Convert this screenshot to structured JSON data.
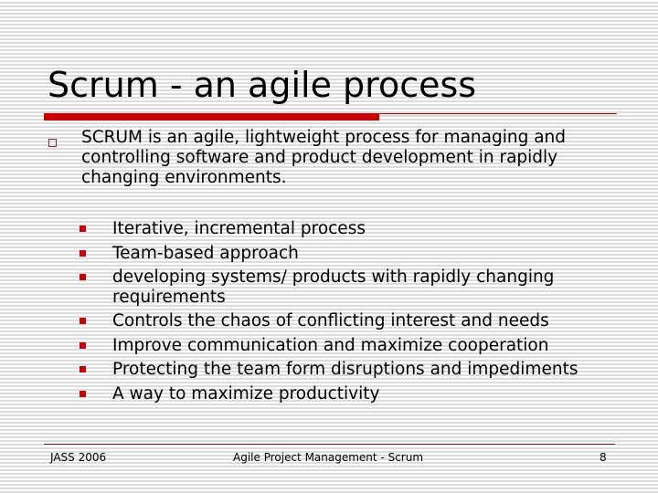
{
  "slide": {
    "title": "Scrum - an agile process",
    "main_bullet": "SCRUM is an agile, lightweight process for managing and controlling software and product development in rapidly changing environments.",
    "sub_bullets": [
      "Iterative, incremental process",
      "Team-based approach",
      "developing systems/ products with rapidly changing requirements",
      "Controls the chaos of conflicting interest and needs",
      "Improve communication and maximize cooperation",
      "Protecting the team form disruptions and impediments",
      "A way to maximize productivity"
    ]
  },
  "footer": {
    "left": "JASS 2006",
    "center": "Agile Project Management - Scrum",
    "page_number": "8"
  },
  "colors": {
    "accent": "#cc0000",
    "bullet_outline": "#8b2b2b",
    "footer_line": "#6b2222"
  }
}
